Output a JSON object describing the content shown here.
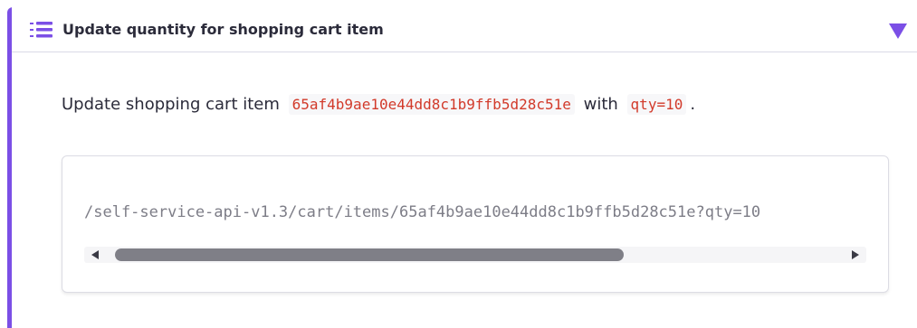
{
  "panel": {
    "title": "Update quantity for shopping cart item",
    "accent_color": "#7b4fe6",
    "header_icon": "numbered-list-icon",
    "toggle_icon": "triangle-down-icon"
  },
  "description": {
    "prefix": "Update shopping cart item",
    "item_id": "65af4b9ae10e44dd8c1b9ffb5d28c51e",
    "middle": "with",
    "qty": "qty=10",
    "suffix": "."
  },
  "code": {
    "path": "/self-service-api-v1.3/cart/items/65af4b9ae10e44dd8c1b9ffb5d28c51e?qty=10"
  },
  "scrollbar": {
    "left_icon": "scroll-left-icon",
    "right_icon": "scroll-right-icon"
  }
}
